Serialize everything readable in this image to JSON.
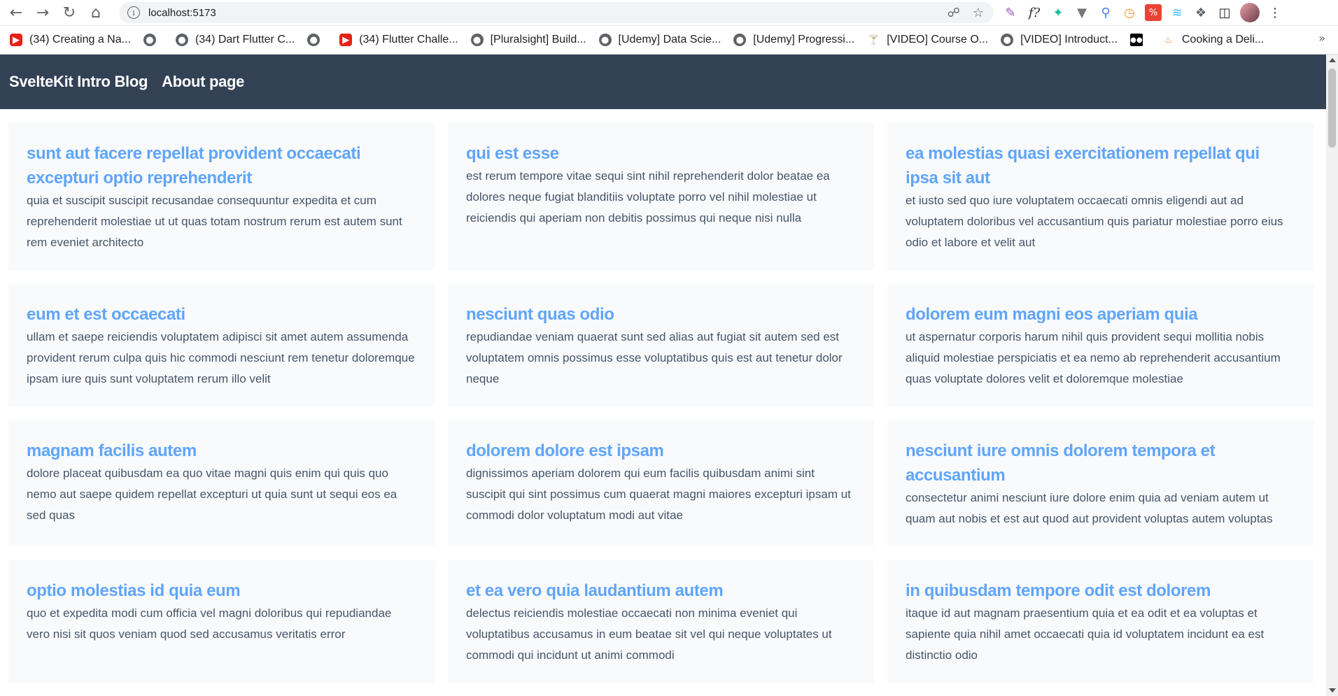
{
  "browser": {
    "url": "localhost:5173",
    "bookmarks": [
      {
        "label": "(34) Creating a Na...",
        "icon": "youtube-icon"
      },
      {
        "label": "",
        "icon": "globe-icon"
      },
      {
        "label": "(34) Dart Flutter C...",
        "icon": "globe-icon"
      },
      {
        "label": "",
        "icon": "globe-icon"
      },
      {
        "label": "(34) Flutter Challe...",
        "icon": "youtube-icon"
      },
      {
        "label": "[Pluralsight] Build...",
        "icon": "globe-icon"
      },
      {
        "label": "[Udemy] Data Scie...",
        "icon": "globe-icon"
      },
      {
        "label": "[Udemy] Progressi...",
        "icon": "globe-icon"
      },
      {
        "label": "[VIDEO] Course O...",
        "icon": "page-icon"
      },
      {
        "label": "[VIDEO] Introduct...",
        "icon": "globe-icon"
      },
      {
        "label": "",
        "icon": "medium-icon"
      },
      {
        "label": "Cooking a Deli...",
        "icon": "cooking-icon"
      }
    ],
    "more_bookmarks": "»"
  },
  "nav": {
    "brand": "SvelteKit Intro Blog",
    "about": "About page"
  },
  "posts": [
    {
      "title": "sunt aut facere repellat provident occaecati excepturi optio reprehenderit",
      "body": "quia et suscipit suscipit recusandae consequuntur expedita et cum reprehenderit molestiae ut ut quas totam nostrum rerum est autem sunt rem eveniet architecto"
    },
    {
      "title": "qui est esse",
      "body": "est rerum tempore vitae sequi sint nihil reprehenderit dolor beatae ea dolores neque fugiat blanditiis voluptate porro vel nihil molestiae ut reiciendis qui aperiam non debitis possimus qui neque nisi nulla"
    },
    {
      "title": "ea molestias quasi exercitationem repellat qui ipsa sit aut",
      "body": "et iusto sed quo iure voluptatem occaecati omnis eligendi aut ad voluptatem doloribus vel accusantium quis pariatur molestiae porro eius odio et labore et velit aut"
    },
    {
      "title": "eum et est occaecati",
      "body": "ullam et saepe reiciendis voluptatem adipisci sit amet autem assumenda provident rerum culpa quis hic commodi nesciunt rem tenetur doloremque ipsam iure quis sunt voluptatem rerum illo velit"
    },
    {
      "title": "nesciunt quas odio",
      "body": "repudiandae veniam quaerat sunt sed alias aut fugiat sit autem sed est voluptatem omnis possimus esse voluptatibus quis est aut tenetur dolor neque"
    },
    {
      "title": "dolorem eum magni eos aperiam quia",
      "body": "ut aspernatur corporis harum nihil quis provident sequi mollitia nobis aliquid molestiae perspiciatis et ea nemo ab reprehenderit accusantium quas voluptate dolores velit et doloremque molestiae"
    },
    {
      "title": "magnam facilis autem",
      "body": "dolore placeat quibusdam ea quo vitae magni quis enim qui quis quo nemo aut saepe quidem repellat excepturi ut quia sunt ut sequi eos ea sed quas"
    },
    {
      "title": "dolorem dolore est ipsam",
      "body": "dignissimos aperiam dolorem qui eum facilis quibusdam animi sint suscipit qui sint possimus cum quaerat magni maiores excepturi ipsam ut commodi dolor voluptatum modi aut vitae"
    },
    {
      "title": "nesciunt iure omnis dolorem tempora et accusantium",
      "body": "consectetur animi nesciunt iure dolore enim quia ad veniam autem ut quam aut nobis et est aut quod aut provident voluptas autem voluptas"
    },
    {
      "title": "optio molestias id quia eum",
      "body": "quo et expedita modi cum officia vel magni doloribus qui repudiandae vero nisi sit quos veniam quod sed accusamus veritatis error"
    },
    {
      "title": "et ea vero quia laudantium autem",
      "body": "delectus reiciendis molestiae occaecati non minima eveniet qui voluptatibus accusamus in eum beatae sit vel qui neque voluptates ut commodi qui incidunt ut animi commodi"
    },
    {
      "title": "in quibusdam tempore odit est dolorem",
      "body": "itaque id aut magnam praesentium quia et ea odit et ea voluptas et sapiente quia nihil amet occaecati quia id voluptatem incidunt ea est distinctio odio"
    }
  ],
  "colors": {
    "navbar": "#334155",
    "title": "#60a5fa",
    "body": "#475569",
    "card": "#f8fafc"
  }
}
